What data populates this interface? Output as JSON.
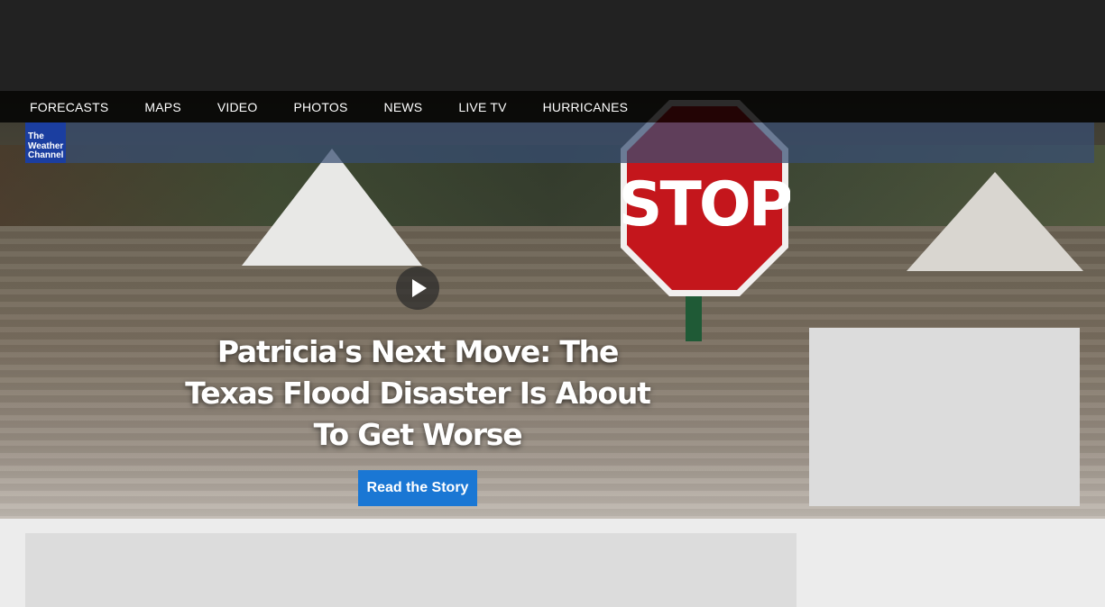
{
  "nav": {
    "items": [
      "FORECASTS",
      "MAPS",
      "VIDEO",
      "PHOTOS",
      "NEWS",
      "LIVE TV",
      "HURRICANES"
    ]
  },
  "logo": {
    "line1": "The",
    "line2": "Weather",
    "line3": "Channel"
  },
  "hero": {
    "sign_text": "STOP",
    "headline": "Patricia's Next Move: The Texas Flood Disaster Is About To Get Worse",
    "cta_label": "Read the Story",
    "play_icon": "play-icon"
  },
  "colors": {
    "top_bar": "#222222",
    "nav_bg": "#000000",
    "logo_bg": "#1b3ea0",
    "cta_bg": "#1a77d4",
    "placeholder": "#dcdcdc",
    "page_bg": "#ececec"
  }
}
